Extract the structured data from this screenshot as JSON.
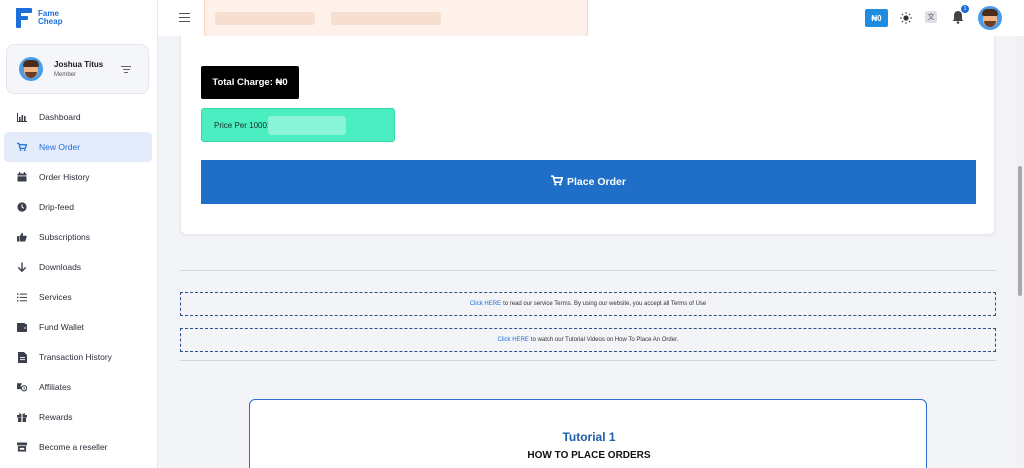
{
  "brand": {
    "name_line1": "Fame",
    "name_line2": "Cheap",
    "accent": "#1e6fd9"
  },
  "user": {
    "name": "Joshua Titus",
    "role": "Member"
  },
  "sidebar": {
    "items": [
      {
        "label": "Dashboard",
        "icon": "chart-icon"
      },
      {
        "label": "New Order",
        "icon": "cart-icon",
        "active": true
      },
      {
        "label": "Order History",
        "icon": "calendar-icon"
      },
      {
        "label": "Drip-feed",
        "icon": "clock-icon"
      },
      {
        "label": "Subscriptions",
        "icon": "thumbs-up-icon"
      },
      {
        "label": "Downloads",
        "icon": "arrow-down-icon"
      },
      {
        "label": "Services",
        "icon": "list-icon"
      },
      {
        "label": "Fund Wallet",
        "icon": "wallet-icon"
      },
      {
        "label": "Transaction History",
        "icon": "receipt-icon"
      },
      {
        "label": "Affiliates",
        "icon": "affiliates-icon"
      },
      {
        "label": "Rewards",
        "icon": "gift-icon"
      },
      {
        "label": "Become a reseller",
        "icon": "store-icon"
      }
    ]
  },
  "topbar": {
    "balance": "₦0",
    "notification_count": "1",
    "lang_glyph": "文"
  },
  "order": {
    "total_charge_label": "Total Charge: ₦0",
    "price_per_label": "Price Per 1000:",
    "place_order_label": "Place Order",
    "button_color": "#1f6fc8",
    "price_box_color": "#4aeec0"
  },
  "notices": {
    "terms": {
      "link": "Click HERE",
      "text": "to read our service Terms. By using our website, you accept all Terms of Use"
    },
    "tutorial": {
      "link": "Click HERE",
      "text": "to watch our Tutorial Videos on How To Place An Order."
    }
  },
  "tutorial": {
    "title": "Tutorial 1",
    "subtitle": "HOW TO PLACE ORDERS"
  }
}
